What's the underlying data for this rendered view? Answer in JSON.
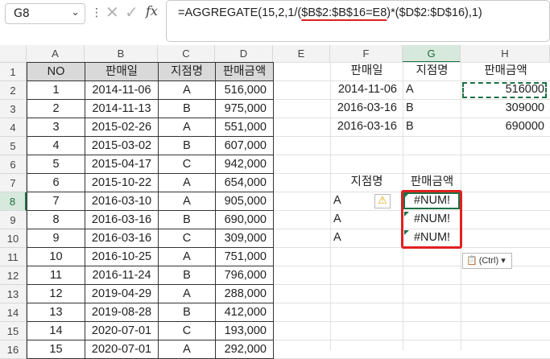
{
  "formula_bar": {
    "name_box": "G8",
    "formula_prefix": "=AGGREGATE(15,2,1/(",
    "formula_highlight": "$B$2:$B$16=E8",
    "formula_suffix": ")*($D$2:$D$16),1)",
    "fx_label": "fx"
  },
  "columns": [
    "A",
    "B",
    "C",
    "D",
    "E",
    "F",
    "G",
    "H"
  ],
  "rows": [
    "1",
    "2",
    "3",
    "4",
    "5",
    "6",
    "7",
    "8",
    "9",
    "10",
    "11",
    "12",
    "13",
    "14",
    "15",
    "16"
  ],
  "table": {
    "headers": [
      "NO",
      "판매일",
      "지점명",
      "판매금액"
    ],
    "rows": [
      [
        "1",
        "2014-11-06",
        "A",
        "516,000"
      ],
      [
        "2",
        "2014-11-13",
        "B",
        "975,000"
      ],
      [
        "3",
        "2015-02-26",
        "A",
        "551,000"
      ],
      [
        "4",
        "2015-03-02",
        "B",
        "607,000"
      ],
      [
        "5",
        "2015-04-17",
        "C",
        "942,000"
      ],
      [
        "6",
        "2015-10-22",
        "A",
        "654,000"
      ],
      [
        "7",
        "2016-03-10",
        "A",
        "905,000"
      ],
      [
        "8",
        "2016-03-16",
        "B",
        "690,000"
      ],
      [
        "9",
        "2016-03-16",
        "C",
        "309,000"
      ],
      [
        "10",
        "2016-10-25",
        "A",
        "751,000"
      ],
      [
        "11",
        "2016-11-24",
        "B",
        "796,000"
      ],
      [
        "12",
        "2019-04-29",
        "A",
        "288,000"
      ],
      [
        "13",
        "2019-08-28",
        "B",
        "412,000"
      ],
      [
        "14",
        "2020-07-01",
        "C",
        "193,000"
      ],
      [
        "15",
        "2020-07-01",
        "A",
        "292,000"
      ]
    ]
  },
  "side_table": {
    "headers": [
      "판매일",
      "지점명",
      "판매금액"
    ],
    "rows": [
      [
        "2014-11-06",
        "A",
        "516000"
      ],
      [
        "2016-03-16",
        "B",
        "309000"
      ],
      [
        "2016-03-16",
        "B",
        "690000"
      ]
    ]
  },
  "lookup": {
    "headers": [
      "지점명",
      "판매금액"
    ],
    "rows": [
      [
        "A",
        "#NUM!"
      ],
      [
        "A",
        "#NUM!"
      ],
      [
        "A",
        "#NUM!"
      ]
    ]
  },
  "paste_options_label": "(Ctrl)",
  "colors": {
    "selection_green": "#1e7145",
    "highlight_red": "#e02020",
    "header_fill": "#d9d9d9",
    "warning_yellow": "#f4c542"
  }
}
